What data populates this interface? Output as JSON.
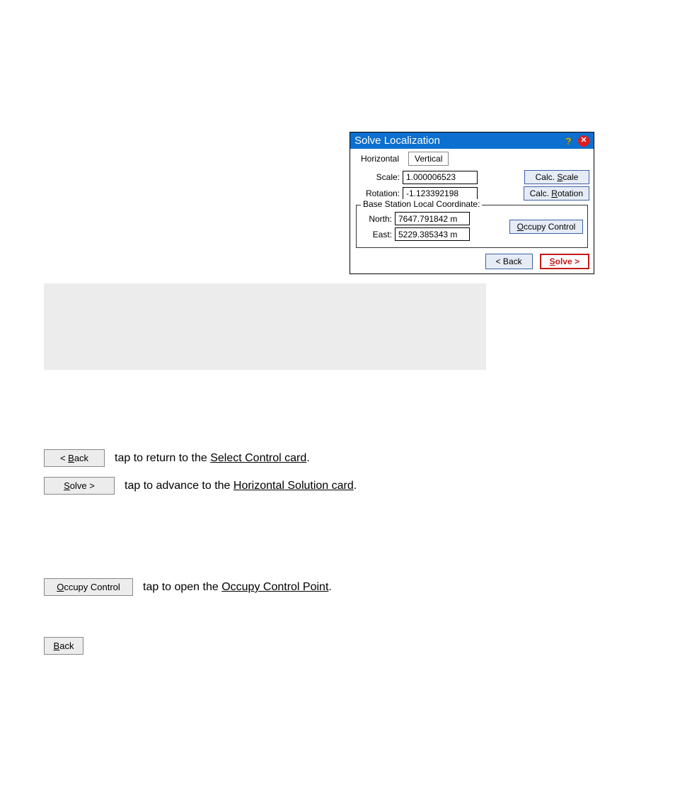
{
  "dialog": {
    "title": "Solve Localization",
    "tabs": {
      "horizontal": "Horizontal",
      "vertical": "Vertical"
    },
    "scale": {
      "label": "Scale:",
      "value": "1.000006523",
      "button_pre": "Calc. ",
      "button_u": "S",
      "button_post": "cale"
    },
    "rotation": {
      "label": "Rotation:",
      "value": "-1.123392198",
      "button_pre": "Calc. ",
      "button_u": "R",
      "button_post": "otation"
    },
    "fieldset": {
      "legend": "Base Station Local Coordinate:",
      "north": {
        "label": "North:",
        "value": "7647.791842 m"
      },
      "east": {
        "label": "East:",
        "value": "5229.385343 m"
      },
      "occupy_u": "O",
      "occupy_post": "ccupy Control"
    },
    "back_pre": "< ",
    "back_u": "B",
    "back_post": "ack",
    "solve_u": "S",
    "solve_post": "olve >"
  },
  "doc": {
    "step_back_pre": "< ",
    "step_back_u": "B",
    "step_back_post": "ack",
    "step_back_text_pre": "tap to return to the ",
    "step_back_link": "Select Control card",
    "step_back_text_post": ".",
    "step_solve_u": "S",
    "step_solve_post": "olve >",
    "step_solve_text_pre": "tap to advance to the ",
    "step_solve_link": "Horizontal Solution card",
    "step_solve_text_post": ".",
    "step_occupy_u": "O",
    "step_occupy_post": "ccupy Control",
    "step_occupy_text_pre": "tap to open the ",
    "step_occupy_link": "Occupy Control Point",
    "step_occupy_text_post": ".",
    "step_b_u": "B",
    "step_b_post": "ack"
  }
}
